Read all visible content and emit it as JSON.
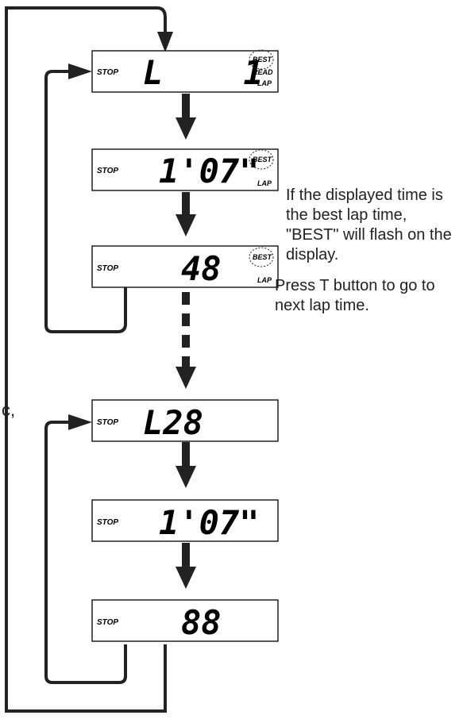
{
  "displays": [
    {
      "id": "lap-number-1",
      "stop": "STOP",
      "main": "L    1",
      "badges": [
        "BEST",
        "READ",
        "LAP"
      ],
      "best_circled": true
    },
    {
      "id": "lap-time-1",
      "stop": "STOP",
      "main": "1'07\"",
      "badges": [
        "BEST",
        "LAP"
      ],
      "best_circled": true
    },
    {
      "id": "lap-sub-1",
      "stop": "STOP",
      "main": "48",
      "badges": [
        "BEST",
        "LAP"
      ],
      "best_circled": true
    },
    {
      "id": "lap-number-28",
      "stop": "STOP",
      "main": "L28",
      "badges": [],
      "best_circled": false
    },
    {
      "id": "lap-time-28",
      "stop": "STOP",
      "main": "1'07\"",
      "badges": [],
      "best_circled": false
    },
    {
      "id": "lap-sub-28",
      "stop": "STOP",
      "main": "88",
      "badges": [],
      "best_circled": false
    }
  ],
  "notes": {
    "best_flash": "If the displayed time is the best lap time, \"BEST\" will flash on the display.",
    "press_t": "Press T button to go to next lap time."
  },
  "cropped_text": "c,",
  "colors": {
    "line": "#222222",
    "text": "#222222"
  }
}
